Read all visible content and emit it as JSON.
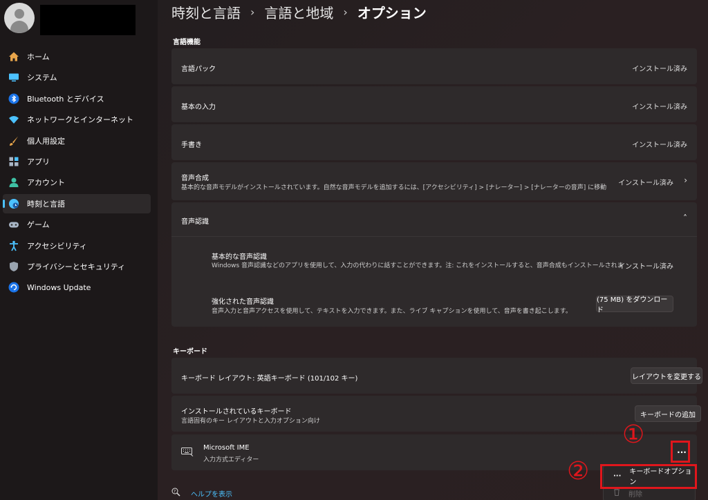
{
  "sidebar": {
    "items": [
      {
        "label": "ホーム",
        "icon": "home-icon"
      },
      {
        "label": "システム",
        "icon": "system-icon"
      },
      {
        "label": "Bluetooth とデバイス",
        "icon": "bluetooth-icon"
      },
      {
        "label": "ネットワークとインターネット",
        "icon": "wifi-icon"
      },
      {
        "label": "個人用設定",
        "icon": "brush-icon"
      },
      {
        "label": "アプリ",
        "icon": "apps-icon"
      },
      {
        "label": "アカウント",
        "icon": "account-icon"
      },
      {
        "label": "時刻と言語",
        "icon": "time-language-icon"
      },
      {
        "label": "ゲーム",
        "icon": "gamepad-icon"
      },
      {
        "label": "アクセシビリティ",
        "icon": "accessibility-icon"
      },
      {
        "label": "プライバシーとセキュリティ",
        "icon": "shield-icon"
      },
      {
        "label": "Windows Update",
        "icon": "update-icon"
      }
    ]
  },
  "breadcrumb": {
    "level1": "時刻と言語",
    "level2": "言語と地域",
    "current": "オプション",
    "separator": "›"
  },
  "language_features": {
    "title": "言語機能",
    "language_pack": {
      "label": "言語パック",
      "status": "インストール済み"
    },
    "basic_typing": {
      "label": "基本の入力",
      "status": "インストール済み"
    },
    "handwriting": {
      "label": "手書き",
      "status": "インストール済み"
    },
    "tts": {
      "label": "音声合成",
      "description": "基本的な音声モデルがインストールされています。自然な音声モデルを追加するには、[アクセシビリティ] > [ナレーター] > [ナレーターの音声] に移動",
      "status": "インストール済み"
    },
    "speech": {
      "label": "音声認識",
      "basic": {
        "label": "基本的な音声認識",
        "description": "Windows 音声認識などのアプリを使用して、入力の代わりに話すことができます。注: これをインストールすると、音声合成もインストールされま",
        "status": "インストール済み"
      },
      "enhanced": {
        "label": "強化された音声認識",
        "description": "音声入力と音声アクセスを使用して、テキストを入力できます。また、ライブ キャプションを使用して、音声を書き起こします。",
        "button": "(75 MB) をダウンロード"
      }
    }
  },
  "keyboard": {
    "title": "キーボード",
    "layout": {
      "label": "キーボード レイアウト: 英語キーボード (101/102 キー)",
      "button": "レイアウトを変更する"
    },
    "installed": {
      "label": "インストールされているキーボード",
      "sub": "言語固有のキー レイアウトと入力オプション向け",
      "button": "キーボードの追加"
    },
    "ime": {
      "name": "Microsoft IME",
      "sub": "入力方式エディター",
      "more": "···"
    }
  },
  "context_menu": {
    "options": "キーボードオプション",
    "options_icon": "···",
    "delete": "削除"
  },
  "annotations": {
    "one": "①",
    "two": "②"
  },
  "help": {
    "label": "ヘルプを表示"
  },
  "colors": {
    "accent": "#4cc2ff",
    "highlight": "#e0161c"
  }
}
